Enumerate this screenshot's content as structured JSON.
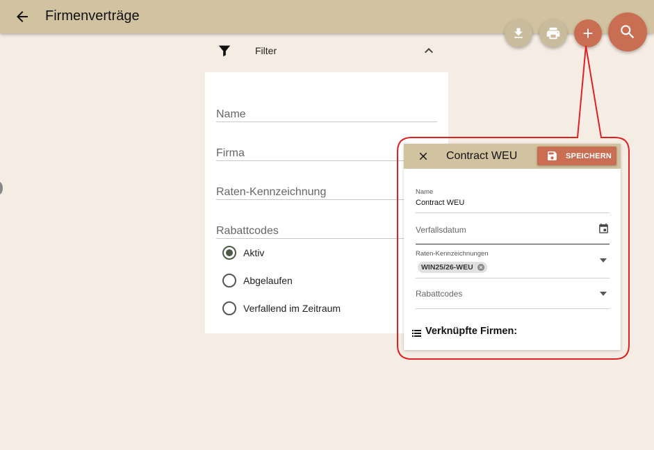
{
  "header": {
    "title": "Firmenverträge"
  },
  "actions": {
    "download": "download-icon",
    "print": "print-icon",
    "add": "add-icon",
    "search": "search-icon"
  },
  "filter": {
    "label": "Filter",
    "fields": [
      "Name",
      "Firma",
      "Raten-Kennzeichnung",
      "Rabattcodes"
    ],
    "status_options": [
      "Aktiv",
      "Abgelaufen",
      "Verfallend im Zeitraum"
    ],
    "selected_status": "Aktiv"
  },
  "dialog": {
    "title": "Contract WEU",
    "save_label": "SPEICHERN",
    "name_label": "Name",
    "name_value": "Contract WEU",
    "expiry_placeholder": "Verfallsdatum",
    "rate_codes_label": "Raten-Kennzeichnungen",
    "rate_codes_chips": [
      "WIN25/26-WEU"
    ],
    "discount_placeholder": "Rabattcodes",
    "linked_companies_title": "Verknüpfte Firmen:"
  },
  "colors": {
    "appbar": "#d2c3a0",
    "background": "#f5ece3",
    "accent": "#c96e53",
    "callout": "#e02020"
  }
}
